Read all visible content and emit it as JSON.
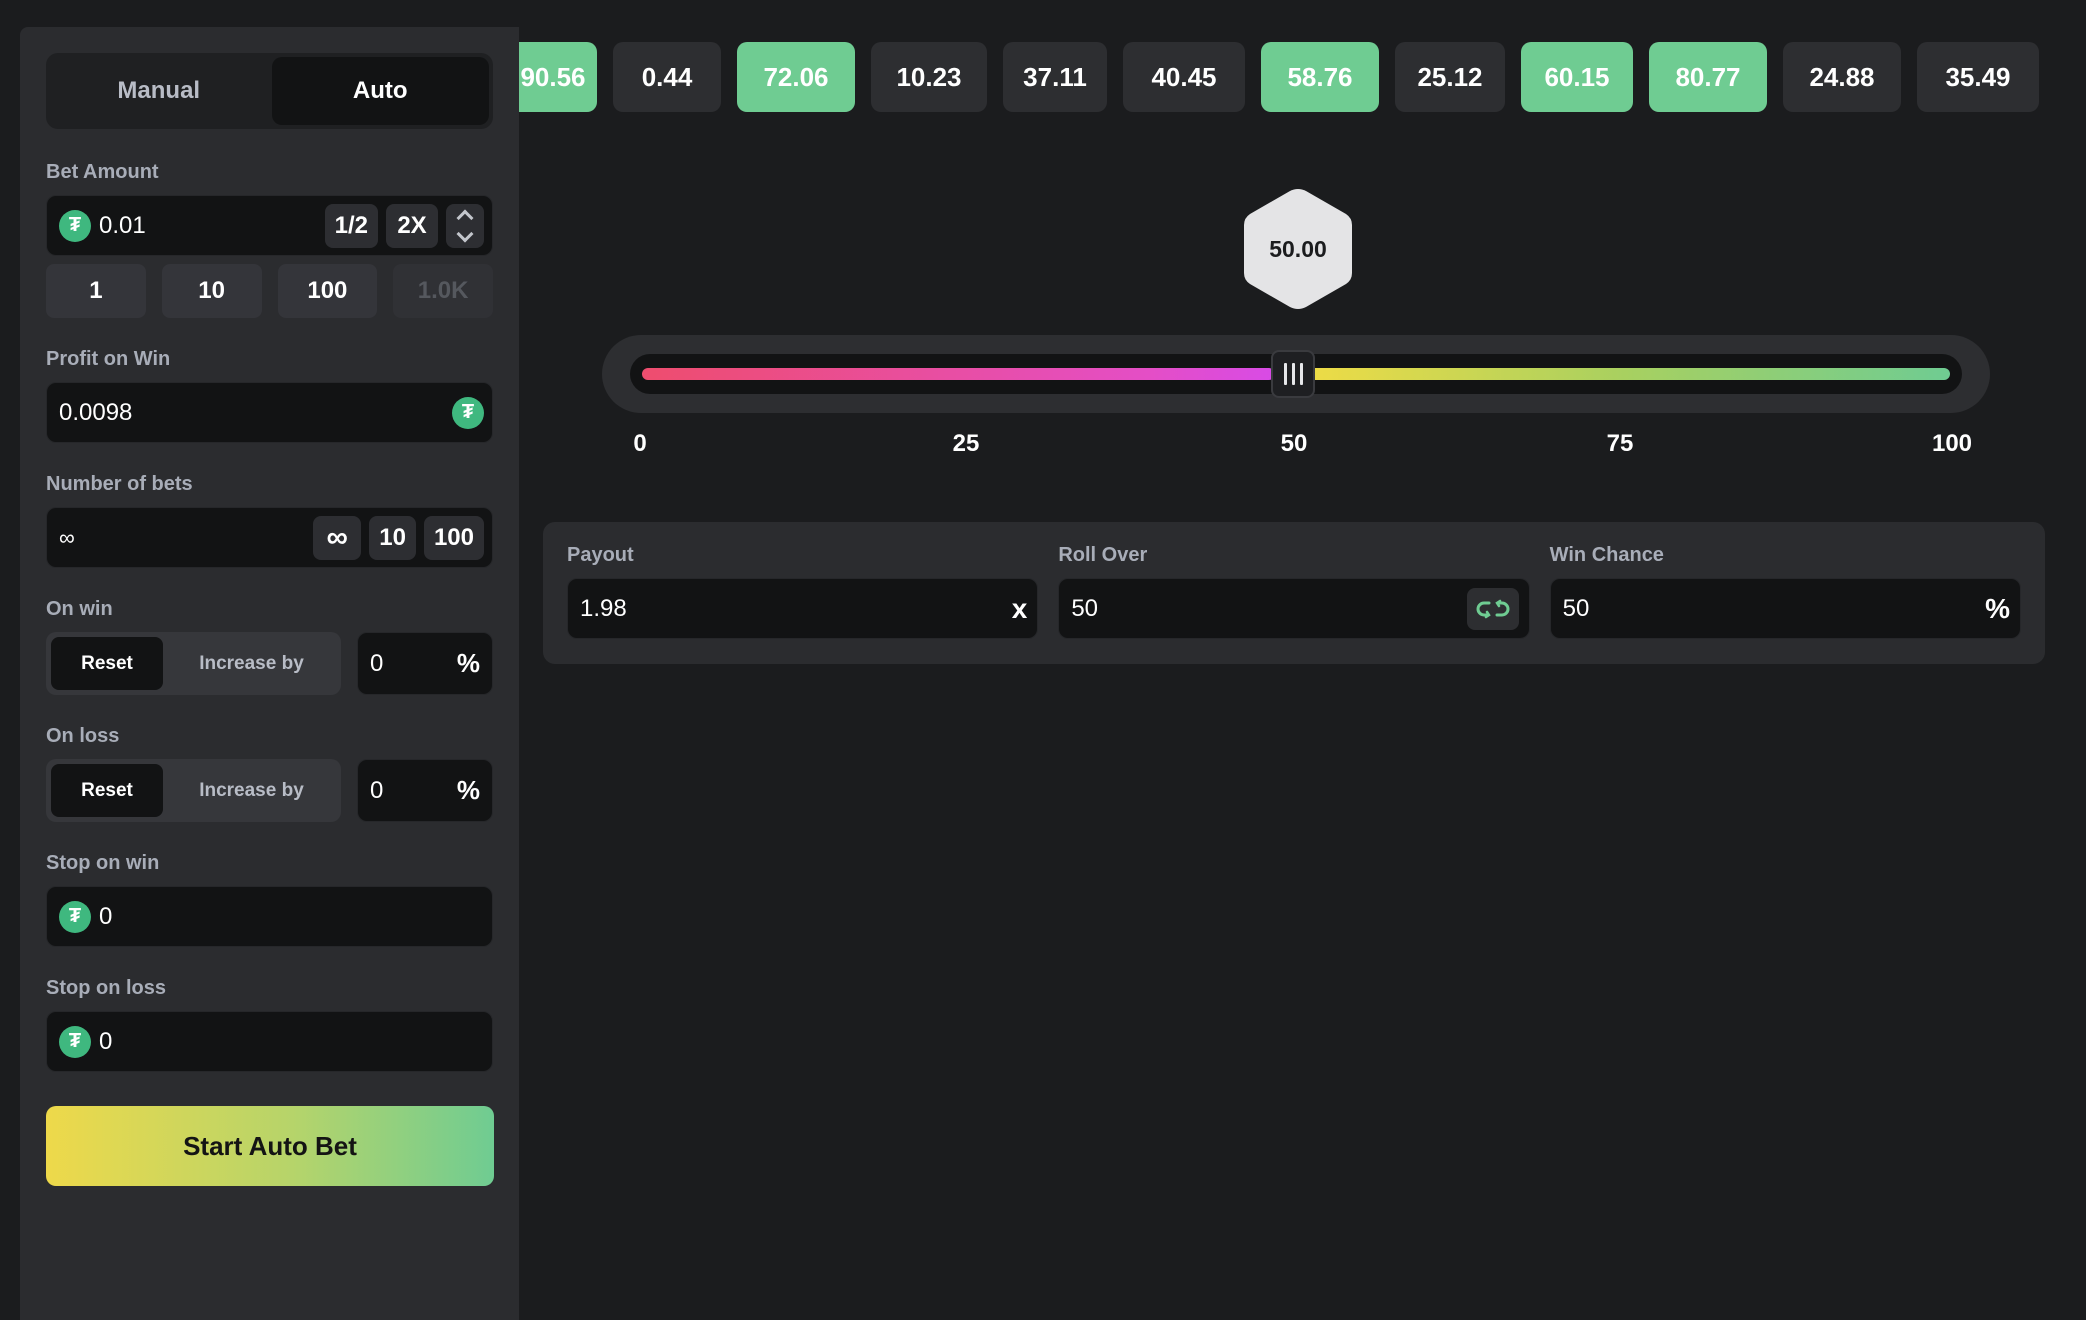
{
  "mode": {
    "manual_label": "Manual",
    "auto_label": "Auto",
    "active": "Auto"
  },
  "bet_amount": {
    "label": "Bet Amount",
    "value": "0.01",
    "half_label": "1/2",
    "double_label": "2X",
    "currency_icon": "tether-coin-icon",
    "presets": [
      "1",
      "10",
      "100",
      "1.0K"
    ]
  },
  "profit_on_win": {
    "label": "Profit on Win",
    "value": "0.0098",
    "currency_icon": "tether-coin-icon"
  },
  "number_of_bets": {
    "label": "Number of bets",
    "value": "∞",
    "infinity_label": "∞",
    "preset_10": "10",
    "preset_100": "100"
  },
  "on_win": {
    "label": "On win",
    "reset_label": "Reset",
    "increase_label": "Increase by",
    "value": "0",
    "unit": "%"
  },
  "on_loss": {
    "label": "On loss",
    "reset_label": "Reset",
    "increase_label": "Increase by",
    "value": "0",
    "unit": "%"
  },
  "stop_on_win": {
    "label": "Stop on win",
    "value": "0"
  },
  "stop_on_loss": {
    "label": "Stop on loss",
    "value": "0"
  },
  "start_button": {
    "label": "Start Auto Bet"
  },
  "recent_results": [
    {
      "value": "90.56",
      "win": true
    },
    {
      "value": "0.44",
      "win": false
    },
    {
      "value": "72.06",
      "win": true
    },
    {
      "value": "10.23",
      "win": false
    },
    {
      "value": "37.11",
      "win": false
    },
    {
      "value": "40.45",
      "win": false
    },
    {
      "value": "58.76",
      "win": true
    },
    {
      "value": "25.12",
      "win": false
    },
    {
      "value": "60.15",
      "win": true
    },
    {
      "value": "80.77",
      "win": true
    },
    {
      "value": "24.88",
      "win": false
    },
    {
      "value": "35.49",
      "win": false
    }
  ],
  "slider": {
    "current_value_label": "50.00",
    "value": 50,
    "min": 0,
    "max": 100,
    "tick_labels": [
      "0",
      "25",
      "50",
      "75",
      "100"
    ]
  },
  "params": {
    "payout": {
      "label": "Payout",
      "value": "1.98",
      "suffix": "x"
    },
    "roll_over": {
      "label": "Roll Over",
      "value": "50",
      "icon": "swap-link-icon"
    },
    "win_chance": {
      "label": "Win Chance",
      "value": "50",
      "suffix": "%"
    }
  },
  "colors": {
    "win_chip": "#6fcc92",
    "loss_chip": "#2d2e31",
    "accent_green": "#3fb87f",
    "accent_yellow": "#eed94a",
    "lose_track": "#ee4d6e"
  }
}
